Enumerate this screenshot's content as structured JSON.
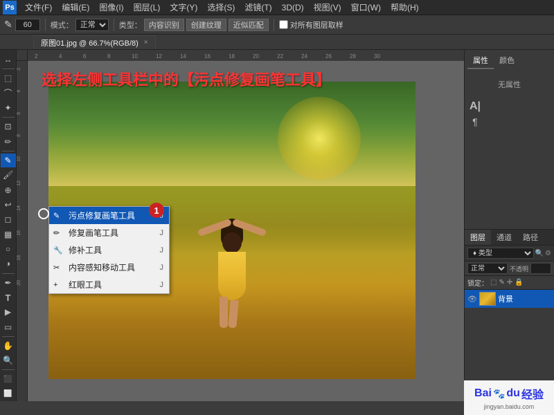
{
  "app": {
    "title": "Adobe Photoshop",
    "menu_items": [
      "文件(F)",
      "编辑(E)",
      "图像(I)",
      "图层(L)",
      "文字(Y)",
      "选择(S)",
      "滤镜(T)",
      "3D(D)",
      "视图(V)",
      "窗口(W)",
      "帮助(H)"
    ]
  },
  "options_bar": {
    "size_value": "60",
    "mode_label": "模式：",
    "mode_value": "正常",
    "type_label": "类型：",
    "type_options": [
      "内容识别",
      "创建纹理",
      "近似匹配"
    ],
    "checkbox_label": "对所有图层取样"
  },
  "tab": {
    "label": "原图01.jpg @ 66.7%(RGB/8)",
    "close": "×"
  },
  "instruction": {
    "text": "选择左侧工具栏中的【污点修复画笔工具】"
  },
  "context_menu": {
    "items": [
      {
        "icon": "✎",
        "label": "污点修复画笔工具",
        "shortcut": "J",
        "selected": true
      },
      {
        "icon": "✏",
        "label": "修复画笔工具",
        "shortcut": "J",
        "selected": false
      },
      {
        "icon": "✂",
        "label": "修补工具",
        "shortcut": "J",
        "selected": false
      },
      {
        "icon": "⊕",
        "label": "内容感知移动工具",
        "shortcut": "J",
        "selected": false
      },
      {
        "icon": "+",
        "label": "红眼工具",
        "shortcut": "J",
        "selected": false
      }
    ]
  },
  "step_badge": "1",
  "right_panel": {
    "top_tabs": [
      "属性",
      "颜色"
    ],
    "active_top_tab": "属性",
    "no_attr_text": "无属性",
    "icon_labels": [
      "A|",
      "¶"
    ]
  },
  "layers_panel": {
    "tabs": [
      "图层",
      "通道",
      "路径"
    ],
    "active_tab": "图层",
    "search_placeholder": "♦ 类型",
    "blend_mode": "正常",
    "opacity_label": "不透明",
    "opacity_value": "",
    "lock_label": "锁定：",
    "layer_name": "背景",
    "layer_eye": "👁"
  },
  "baidu": {
    "logo": "Bai",
    "paw": "🐾",
    "du": "du",
    "suffix": "经验",
    "url": "jingyan.baidu.com"
  },
  "colors": {
    "menu_bg": "#2b2b2b",
    "toolbar_bg": "#2e2e2e",
    "canvas_bg": "#646464",
    "active_blue": "#1158b5",
    "ruler_bg": "#3a3a3a",
    "instruction_color": "#ff3333"
  }
}
